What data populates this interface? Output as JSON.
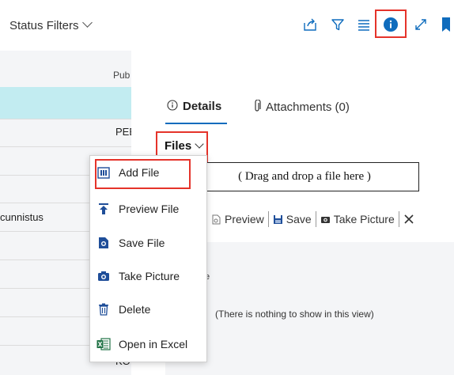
{
  "topbar": {
    "status_filters": "Status Filters",
    "icons": [
      "share-icon",
      "filter-icon",
      "list-icon",
      "info-icon",
      "expand-icon",
      "bookmark-icon"
    ]
  },
  "list": {
    "column_pub": "Pub",
    "row_peb": "PEE",
    "row_cunnistus": "cunnistus",
    "row_ko": "KO"
  },
  "factbox": {
    "tabs": {
      "details": "Details",
      "attachments": "Attachments (0)"
    },
    "files_title": "Files",
    "dropzone": "( Drag and drop a file here )",
    "toolbar": {
      "preview": "Preview",
      "save": "Save",
      "take_picture": "Take Picture"
    },
    "empty_text": "(There is nothing to show in this view)",
    "partial_text": "e"
  },
  "menu": {
    "items": [
      {
        "label": "Add File",
        "icon": "add-file-icon"
      },
      {
        "label": "Preview File",
        "icon": "upload-arrow-icon"
      },
      {
        "label": "Save File",
        "icon": "save-file-icon"
      },
      {
        "label": "Take Picture",
        "icon": "camera-icon"
      },
      {
        "label": "Delete",
        "icon": "trash-icon"
      },
      {
        "label": "Open in Excel",
        "icon": "excel-icon"
      }
    ]
  },
  "colors": {
    "accent": "#0f6cbd",
    "highlight": "#e5332a",
    "selected_row": "#c2ecf1",
    "excel": "#217346"
  }
}
